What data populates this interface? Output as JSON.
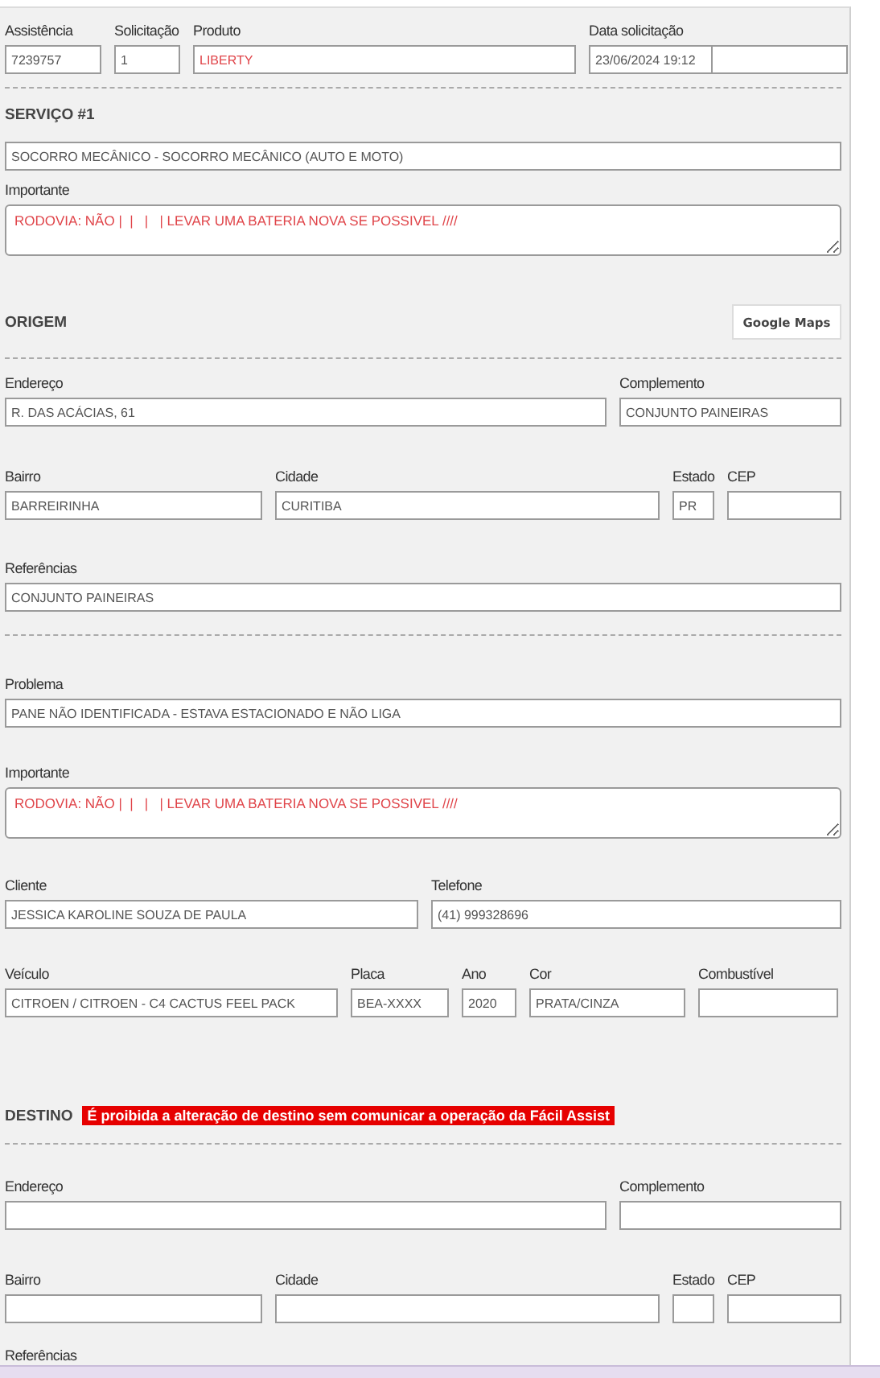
{
  "header": {
    "fields": [
      {
        "label": "Assistência",
        "value": "7239757"
      },
      {
        "label": "Solicitação",
        "value": "1"
      },
      {
        "label": "Produto",
        "value": "LIBERTY"
      },
      {
        "label": "Data solicitação",
        "value": "23/06/2024 19:12"
      }
    ]
  },
  "service": {
    "title": "SERVIÇO #1",
    "value": "SOCORRO MECÂNICO - SOCORRO MECÂNICO (AUTO E MOTO)",
    "important": {
      "label": "Importante",
      "value": "RODOVIA: NÃO |  |   |   | LEVAR UMA BATERIA NOVA SE POSSIVEL ////"
    }
  },
  "origin": {
    "title": "ORIGEM",
    "map_button": "Google Maps",
    "address": {
      "label": "Endereço",
      "value": "R. DAS ACÁCIAS, 61"
    },
    "complement": {
      "label": "Complemento",
      "value": "CONJUNTO PAINEIRAS"
    },
    "district": {
      "label": "Bairro",
      "value": "BARREIRINHA"
    },
    "city": {
      "label": "Cidade",
      "value": "CURITIBA"
    },
    "state": {
      "label": "Estado",
      "value": "PR"
    },
    "zip": {
      "label": "CEP"
    },
    "references": {
      "label": "Referências",
      "value": "CONJUNTO PAINEIRAS"
    }
  },
  "details": {
    "problem": {
      "label": "Problema",
      "value": "PANE NÃO IDENTIFICADA - ESTAVA ESTACIONADO E NÃO LIGA"
    },
    "important": {
      "label": "Importante",
      "value": "RODOVIA: NÃO |  |   |   | LEVAR UMA BATERIA NOVA SE POSSIVEL ////"
    },
    "client": {
      "label": "Cliente",
      "value": "JESSICA KAROLINE SOUZA DE PAULA"
    },
    "phone": {
      "label": "Telefone",
      "value": "(41) 999328696"
    },
    "vehicle": {
      "label": "Veículo",
      "value": "CITROEN / CITROEN - C4 CACTUS FEEL PACK"
    },
    "plate": {
      "label": "Placa",
      "value": "BEA-XXXX"
    },
    "year": {
      "label": "Ano",
      "value": "2020"
    },
    "color": {
      "label": "Cor",
      "value": "PRATA/CINZA"
    },
    "fuel": {
      "label": "Combustível"
    }
  },
  "destination": {
    "title": "DESTINO",
    "warning": "É proibida a alteração de destino sem comunicar a operação da Fácil Assist",
    "address": {
      "label": "Endereço"
    },
    "complement": {
      "label": "Complemento"
    },
    "district": {
      "label": "Bairro"
    },
    "city": {
      "label": "Cidade"
    },
    "state": {
      "label": "Estado"
    },
    "zip": {
      "label": "CEP"
    },
    "references_label": "Referências"
  }
}
